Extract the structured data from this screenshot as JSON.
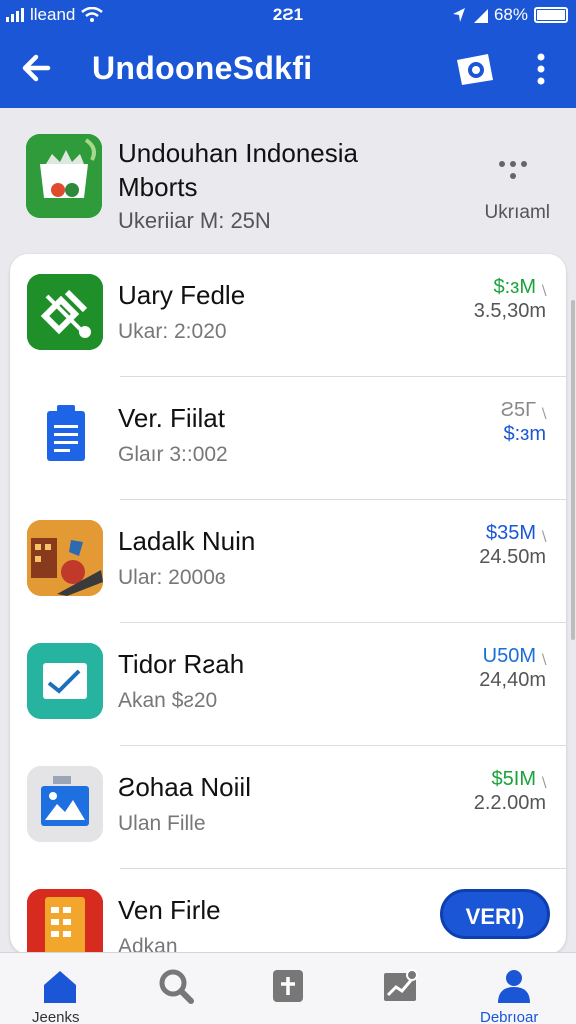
{
  "status_bar": {
    "carrier": "lleand",
    "time": "2Ƨ1",
    "battery": "68%"
  },
  "app_bar": {
    "title": "UndooneSdkfi"
  },
  "pinned": {
    "title_line1": "Undouhan Indonesia",
    "title_line2": "Mborts",
    "subtitle": "Ukeriiar M: 25N",
    "meta": "Ukrıaml"
  },
  "list": [
    {
      "name": "Uary Fedle",
      "sub": "Ukar: 2:020",
      "v1": "$:ɜM",
      "v2": "3.5,30m",
      "v1_color": "#1aa33a"
    },
    {
      "name": "Ver. Fiilat",
      "sub": "Glaır 3::002",
      "v1": "Ƨ5Г",
      "v2": "$:ɜm",
      "v1_color": "#888888"
    },
    {
      "name": "Ladalk Nuin",
      "sub": "Ular: 2000ɞ",
      "v1": "$35M",
      "v2": "24.50m",
      "v1_color": "#1a56d6"
    },
    {
      "name": "Tidor Rƨah",
      "sub": "Akan $ƨ20",
      "v1": "U50M",
      "v2": "24,40m",
      "v1_color": "#1a6fd6"
    },
    {
      "name": "Ƨohaa Noiil",
      "sub": "Ulan Fille",
      "v1": "$5IM",
      "v2": "2.2.00m",
      "v1_color": "#1aa33a"
    },
    {
      "name": "Ven Firle",
      "sub": "Adkan",
      "button": "VERI)"
    }
  ],
  "tabs": [
    {
      "label": "Jeenks",
      "icon": "home-icon"
    },
    {
      "label": "",
      "icon": "search-icon"
    },
    {
      "label": "",
      "icon": "plus-box-icon"
    },
    {
      "label": "",
      "icon": "chart-image-icon"
    },
    {
      "label": "Debrıoar",
      "icon": "person-icon"
    }
  ],
  "colors": {
    "brand": "#1a56d6",
    "tab_active": "#1a56d6",
    "green": "#2f9b3b"
  }
}
